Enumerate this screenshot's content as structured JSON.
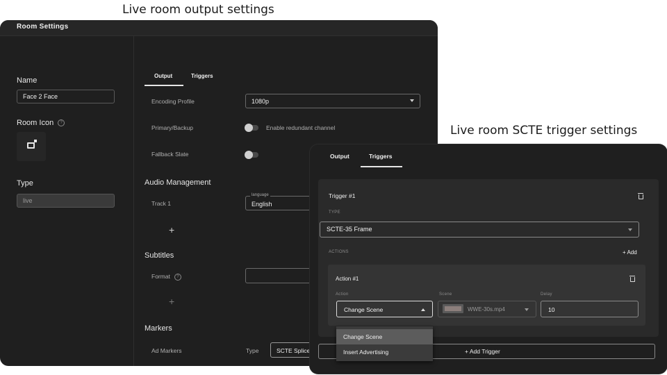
{
  "captions": {
    "output": "Live room output settings",
    "scte": "Live room SCTE trigger settings"
  },
  "window1": {
    "title": "Room Settings",
    "sidebar": {
      "name_label": "Name",
      "name_value": "Face 2 Face",
      "room_icon_label": "Room Icon",
      "type_label": "Type",
      "type_value": "live"
    },
    "tabs": [
      "Output",
      "Triggers"
    ],
    "encoding_profile_label": "Encoding Profile",
    "encoding_profile_value": "1080p",
    "primary_backup_label": "Primary/Backup",
    "redundant_label": "Enable redundant channel",
    "fallback_label": "Fallback Slate",
    "audio_section": "Audio Management",
    "track_label": "Track 1",
    "language_label": "language",
    "language_value": "English",
    "plus": "+",
    "subtitles_section": "Subtitles",
    "format_label": "Format",
    "markers_section": "Markers",
    "ad_markers_label": "Ad Markers",
    "type_label": "Type",
    "marker_type_value": "SCTE Splice"
  },
  "window2": {
    "tabs": [
      "Output",
      "Triggers"
    ],
    "trigger_title": "Trigger #1",
    "type_label": "TYPE",
    "type_value": "SCTE-35 Frame",
    "actions_label": "ACTIONS",
    "add_label": "+ Add",
    "action_title": "Action #1",
    "action_label": "Action",
    "action_value": "Change Scene",
    "scene_label": "Scene",
    "scene_value": "WWE-30s.mp4",
    "delay_label": "Delay",
    "delay_value": "10",
    "dropdown_options": [
      "Change Scene",
      "Insert Advertising"
    ],
    "add_trigger_label": "+ Add Trigger"
  }
}
